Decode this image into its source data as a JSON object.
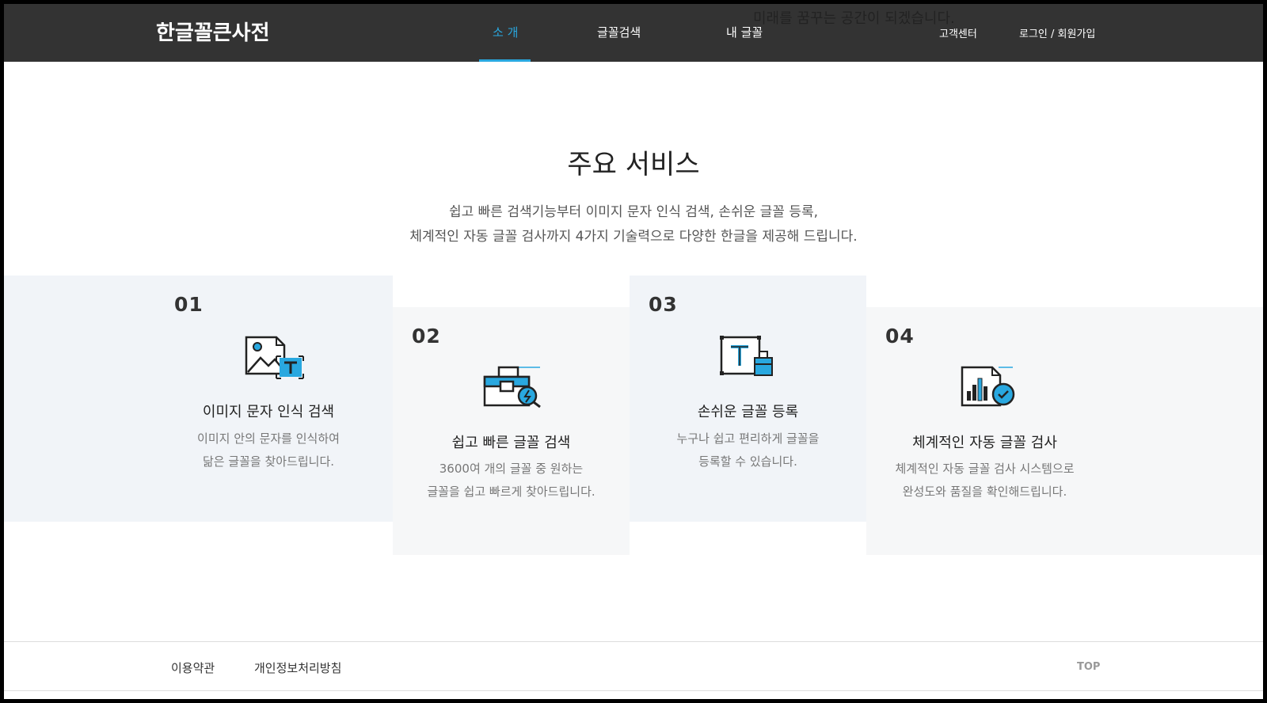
{
  "header": {
    "logo": "한글꼴큰사전",
    "nav": [
      {
        "label": "소 개"
      },
      {
        "label": "글꼴검색"
      },
      {
        "label": "내 글꼴"
      }
    ],
    "overlay_text": "미래를 꿈꾸는 공간이 되겠습니다.",
    "support": "고객센터",
    "login": "로그인 / 회원가입"
  },
  "intro": {
    "title": "주요 서비스",
    "desc_line1": "쉽고 빠른 검색기능부터 이미지 문자 인식 검색, 손쉬운 글꼴 등록,",
    "desc_line2": "체계적인 자동 글꼴 검사까지 4가지 기술력으로 다양한 한글을 제공해 드립니다."
  },
  "services": [
    {
      "num": "01",
      "title": "이미지 문자 인식 검색",
      "desc1": "이미지 안의 문자를 인식하여",
      "desc2": "닮은 글꼴을 찾아드립니다.",
      "icon": "image-text-recognition-icon"
    },
    {
      "num": "02",
      "title": "쉽고 빠른 글꼴 검색",
      "desc1": "3600여 개의 글꼴 중 원하는",
      "desc2": "글꼴을 쉽고 빠르게 찾아드립니다.",
      "icon": "fast-search-icon"
    },
    {
      "num": "03",
      "title": "손쉬운 글꼴 등록",
      "desc1": "누구나 쉽고 편리하게 글꼴을",
      "desc2": "등록할 수 있습니다.",
      "icon": "font-register-icon"
    },
    {
      "num": "04",
      "title": "체계적인 자동 글꼴 검사",
      "desc1": "체계적인 자동 글꼴 검사 시스템으로",
      "desc2": "완성도와 품질을 확인해드립니다.",
      "icon": "auto-inspection-icon"
    }
  ],
  "footer": {
    "terms": "이용약관",
    "privacy": "개인정보처리방침",
    "top": "TOP"
  },
  "colors": {
    "header_bg": "#333333",
    "accent": "#29a8e0",
    "card_a": "#f1f4f8",
    "card_b": "#f6f7f8"
  }
}
